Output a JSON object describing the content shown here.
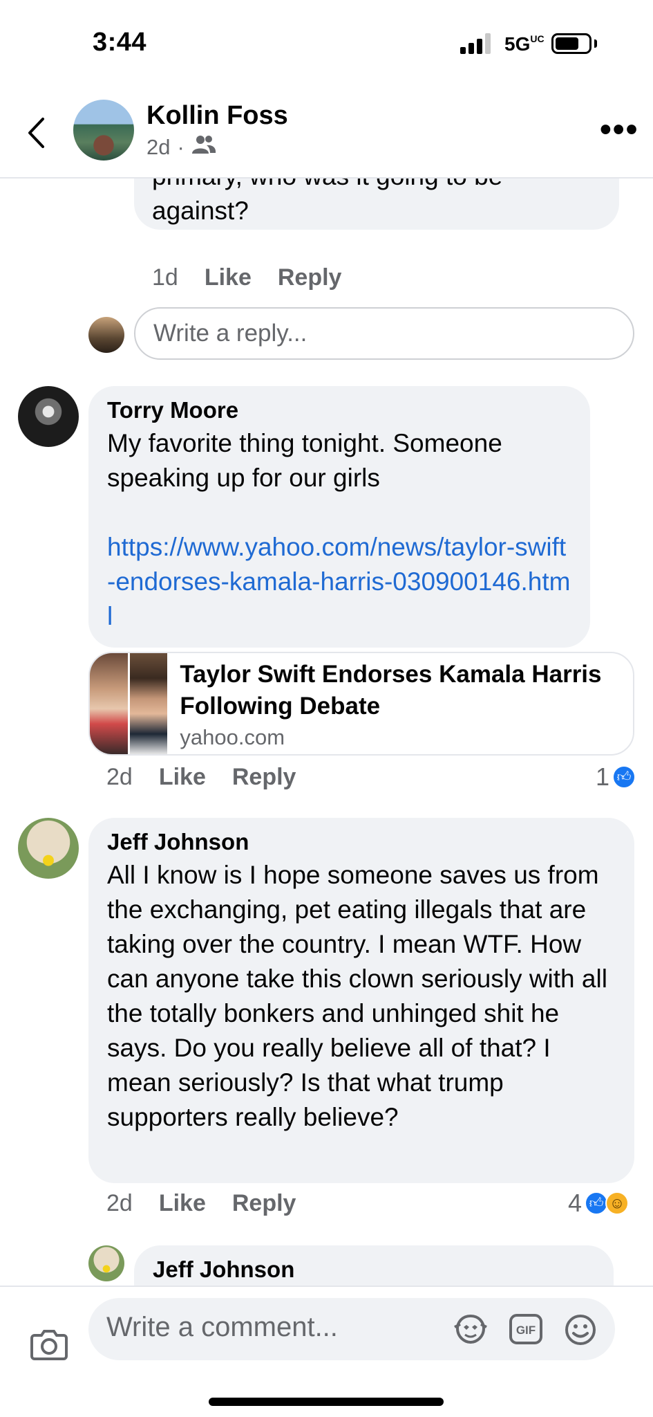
{
  "status": {
    "time": "3:44",
    "network": "5G",
    "network_sup": "UC"
  },
  "header": {
    "back_icon": "chevron-left-icon",
    "name": "Kollin Foss",
    "time_ago": "2d",
    "audience_icon": "friends-icon",
    "more_label": "•••"
  },
  "thread": {
    "prev_comment_tail": "primary, who was it going to be against?",
    "prev_actions": {
      "ago": "1d",
      "like": "Like",
      "reply": "Reply"
    },
    "reply_placeholder": "Write a reply..."
  },
  "comments": [
    {
      "author": "Torry Moore",
      "text": "My favorite thing tonight.  Someone speaking up for our girls",
      "link": "https://www.yahoo.com/news/taylor-swift-endorses-kamala-harris-030900146.html",
      "preview": {
        "title": "Taylor Swift Endorses Kamala Harris Following Debate",
        "domain": "yahoo.com"
      },
      "actions": {
        "ago": "2d",
        "like": "Like",
        "reply": "Reply"
      },
      "reaction_count": "1",
      "reactions": [
        "like"
      ]
    },
    {
      "author": "Jeff Johnson",
      "text": "All I know is I hope someone saves us from the exchanging, pet eating illegals that are taking over the country.  I mean WTF.  How can anyone take this clown seriously with all the totally bonkers and unhinged shit he says.  Do you really believe all of that?  I mean seriously?  Is that what trump supporters really believe?",
      "actions": {
        "ago": "2d",
        "like": "Like",
        "reply": "Reply"
      },
      "reaction_count": "4",
      "reactions": [
        "like",
        "haha"
      ]
    },
    {
      "author": "Jeff Johnson"
    }
  ],
  "composer": {
    "placeholder": "Write a comment...",
    "icons": [
      "camera-icon",
      "avatar-sticker-icon",
      "gif-icon",
      "emoji-icon"
    ]
  },
  "colors": {
    "bubble": "#f0f2f5",
    "link": "#1f6ad3",
    "meta": "#65676b",
    "like_blue": "#1877f2"
  }
}
